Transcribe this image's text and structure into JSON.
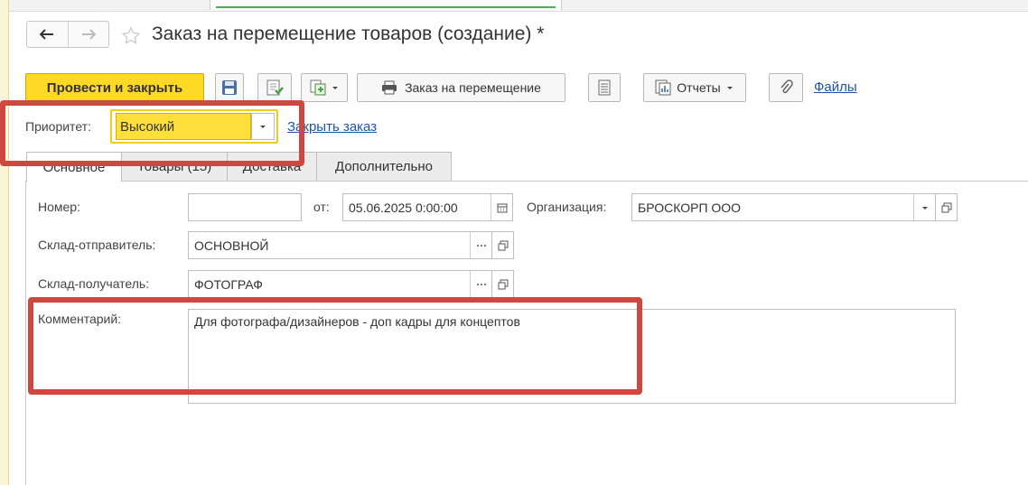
{
  "window": {
    "title": "Заказ на перемещение товаров (создание) *"
  },
  "toolbar": {
    "post_close_label": "Провести и закрыть",
    "print_order_label": "Заказ на перемещение",
    "reports_label": "Отчеты",
    "files_link": "Файлы"
  },
  "priority": {
    "label": "Приоритет:",
    "value": "Высокий",
    "close_order_link": "Закрыть заказ"
  },
  "tabs": [
    {
      "label": "Основное",
      "active": true
    },
    {
      "label": "Товары (15)",
      "active": false
    },
    {
      "label": "Доставка",
      "active": false
    },
    {
      "label": "Дополнительно",
      "active": false
    }
  ],
  "form": {
    "number_label": "Номер:",
    "number_value": "",
    "date_label": "от:",
    "date_value": "05.06.2025  0:00:00",
    "org_label": "Организация:",
    "org_value": "БРОСКОРП ООО",
    "sender_label": "Склад-отправитель:",
    "sender_value": "ОСНОВНОЙ",
    "receiver_label": "Склад-получатель:",
    "receiver_value": "ФОТОГРАФ",
    "comment_label": "Комментарий:",
    "comment_value": "Для фотографа/дизайнеров - доп кадры для концептов"
  },
  "colors": {
    "primary_button": "#ffd924",
    "priority_field": "#ffe03a",
    "annotation_red": "#d0473f",
    "link": "#1d55a8"
  },
  "icons": [
    "back-arrow-icon",
    "forward-arrow-icon",
    "star-icon",
    "save-disk-icon",
    "post-document-icon",
    "create-based-on-icon",
    "printer-icon",
    "list-icon",
    "reports-icon",
    "paperclip-icon",
    "chevron-down-icon",
    "calendar-icon",
    "ellipsis-icon",
    "open-window-icon"
  ]
}
